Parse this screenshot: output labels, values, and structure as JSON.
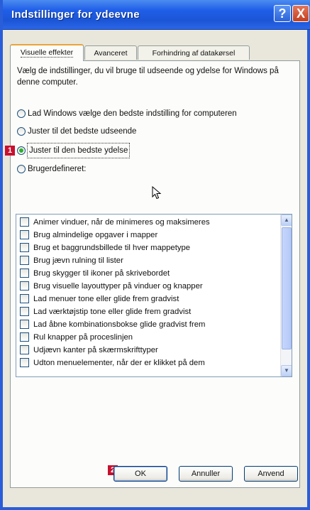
{
  "window": {
    "title": "Indstillinger for ydeevne",
    "help_glyph": "?",
    "close_glyph": "X"
  },
  "tabs": [
    {
      "label": "Visuelle effekter",
      "active": true
    },
    {
      "label": "Avanceret",
      "active": false
    },
    {
      "label": "Forhindring af datakørsel",
      "active": false
    }
  ],
  "description": "Vælg de indstillinger, du vil bruge til udseende og ydelse for Windows på denne computer.",
  "radio_options": [
    {
      "label": "Lad Windows vælge den bedste indstilling for computeren",
      "checked": false
    },
    {
      "label": "Juster til det bedste udseende",
      "checked": false
    },
    {
      "label": "Juster til den bedste ydelse",
      "checked": true
    },
    {
      "label": "Brugerdefineret:",
      "checked": false
    }
  ],
  "effects": [
    {
      "label": "Animer vinduer, når de minimeres og maksimeres",
      "checked": false
    },
    {
      "label": "Brug almindelige opgaver i mapper",
      "checked": false
    },
    {
      "label": "Brug et baggrundsbillede til hver mappetype",
      "checked": false
    },
    {
      "label": "Brug jævn rulning til lister",
      "checked": false
    },
    {
      "label": "Brug skygger til ikoner på skrivebordet",
      "checked": false
    },
    {
      "label": "Brug visuelle layouttyper på vinduer og knapper",
      "checked": false
    },
    {
      "label": "Lad menuer tone eller glide frem gradvist",
      "checked": false
    },
    {
      "label": "Lad værktøjstip tone eller glide frem gradvist",
      "checked": false
    },
    {
      "label": "Lad åbne kombinationsbokse glide gradvist frem",
      "checked": false
    },
    {
      "label": "Rul knapper på proceslinjen",
      "checked": false
    },
    {
      "label": "Udjævn kanter på skærmskrifttyper",
      "checked": false
    },
    {
      "label": "Udton menuelementer, når der er klikket på dem",
      "checked": false
    }
  ],
  "buttons": {
    "ok": "OK",
    "cancel": "Annuller",
    "apply": "Anvend"
  },
  "badges": {
    "step1": "1",
    "step2": "2"
  },
  "colors": {
    "titlebar": "#1f5ee8",
    "radio_selected": "#2bb12b",
    "badge": "#c8102e",
    "tab_highlight": "#e8a43b"
  }
}
